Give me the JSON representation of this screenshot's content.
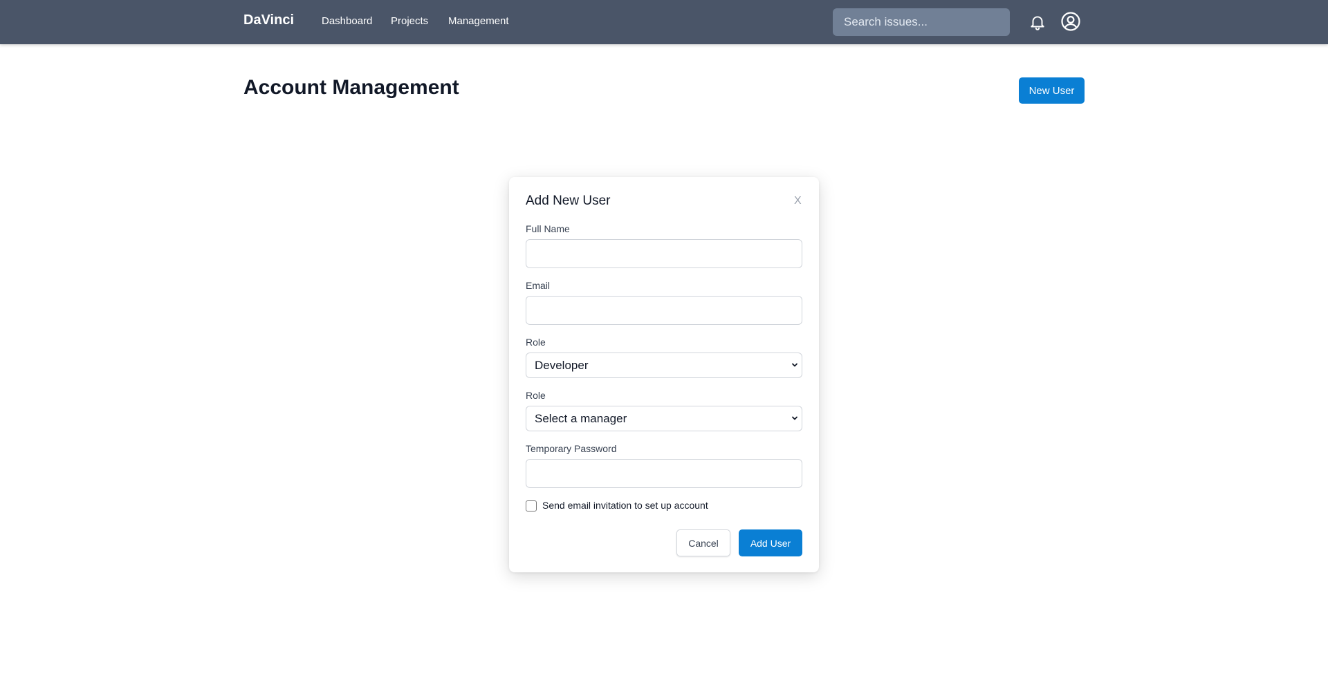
{
  "navbar": {
    "brand": "DaVinci",
    "links": [
      "Dashboard",
      "Projects",
      "Management"
    ],
    "search_placeholder": "Search issues...",
    "icons": [
      "bell-icon",
      "user-circle-icon"
    ],
    "background": "#4a5568"
  },
  "page": {
    "title": "Account Management",
    "new_user_label": "New User",
    "accent": "#0a7fd4"
  },
  "modal": {
    "title": "Add New User",
    "close_label": "X",
    "full_name_label": "Full Name",
    "full_name_value": "",
    "email_label": "Email",
    "email_value": "",
    "role_label": "Role",
    "role_value": "Developer",
    "manager_label": "Role",
    "manager_value": "Select a manager",
    "password_label": "Temporary Password",
    "password_value": "",
    "invite_label": "Send email invitation to set up account",
    "invite_checked": false,
    "cancel_label": "Cancel",
    "submit_label": "Add User"
  }
}
